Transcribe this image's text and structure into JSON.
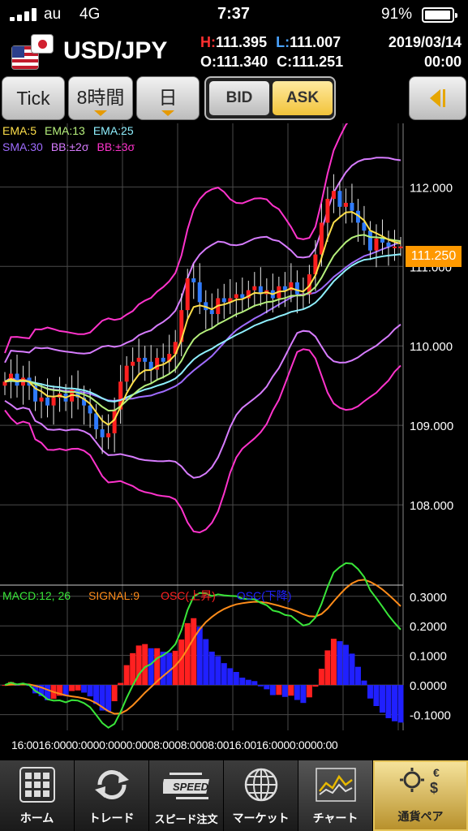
{
  "status_bar": {
    "carrier": "au",
    "network": "4G",
    "time": "7:37",
    "battery": "91%"
  },
  "header": {
    "pair": "USD/JPY",
    "high_label": "H:",
    "high": "111.395",
    "low_label": "L:",
    "low": "111.007",
    "open_label": "O:",
    "open": "111.340",
    "close_label": "C:",
    "close": "111.251",
    "date": "2019/03/14",
    "time": "00:00"
  },
  "toolbar": {
    "tick_label": "Tick",
    "timeframe_label": "8時間",
    "period_label": "日",
    "bid_label": "BID",
    "ask_label": "ASK",
    "selected_side": "ASK"
  },
  "legend_main": [
    {
      "label": "EMA:5",
      "color": "#ffe04a"
    },
    {
      "label": "EMA:13",
      "color": "#b6f07c"
    },
    {
      "label": "EMA:25",
      "color": "#8ff0ff"
    },
    {
      "label": "SMA:30",
      "color": "#9f6cff"
    },
    {
      "label": "BB:±2σ",
      "color": "#d77cff"
    },
    {
      "label": "BB:±3σ",
      "color": "#ff33cc"
    }
  ],
  "legend_sub": [
    {
      "label": "MACD:12, 26",
      "color": "#39e639"
    },
    {
      "label": "SIGNAL:9",
      "color": "#ff8c1a"
    },
    {
      "label": "OSC(上昇)",
      "color": "#ff2020"
    },
    {
      "label": "OSC(下降)",
      "color": "#2020ff"
    }
  ],
  "current_price": "111.250",
  "time_axis": "16:0016:0000:0000:0000:0008:0008:0008:0016:0016:0000:0000:00",
  "colors": {
    "up": "#ff2020",
    "down": "#2f7bff",
    "price_tag": "#ff9900",
    "grid": "#555555"
  },
  "chart_data": {
    "type": "line",
    "main_panel": {
      "ylim": [
        107.0,
        112.8
      ],
      "yticks": [
        "112.000",
        "111.000",
        "110.000",
        "109.000",
        "108.000"
      ],
      "ytick_values": [
        112.0,
        111.0,
        110.0,
        109.0,
        108.0
      ],
      "candles_close": [
        109.55,
        109.65,
        109.5,
        109.6,
        109.5,
        109.3,
        109.35,
        109.25,
        109.35,
        109.4,
        109.3,
        109.45,
        109.35,
        109.25,
        109.15,
        108.95,
        108.85,
        108.9,
        109.2,
        109.55,
        109.75,
        109.8,
        109.85,
        109.8,
        109.7,
        109.85,
        109.8,
        109.9,
        110.05,
        110.45,
        110.85,
        110.8,
        110.55,
        110.45,
        110.4,
        110.6,
        110.55,
        110.6,
        110.65,
        110.6,
        110.7,
        110.75,
        110.65,
        110.7,
        110.6,
        110.75,
        110.7,
        110.8,
        110.65,
        110.65,
        110.9,
        111.15,
        111.55,
        111.85,
        111.95,
        111.75,
        111.8,
        111.7,
        111.55,
        111.45,
        111.2,
        111.35,
        111.3,
        111.25,
        111.25,
        111.25
      ],
      "series": [
        {
          "name": "EMA:5",
          "color": "#ffe04a"
        },
        {
          "name": "EMA:13",
          "color": "#b6f07c"
        },
        {
          "name": "EMA:25",
          "color": "#8ff0ff"
        },
        {
          "name": "SMA:30",
          "color": "#9f6cff"
        },
        {
          "name": "BB:±2σ",
          "color": "#d77cff"
        },
        {
          "name": "BB:±3σ",
          "color": "#ff33cc"
        }
      ]
    },
    "macd_panel": {
      "ylim": [
        -0.145,
        0.335
      ],
      "yticks": [
        "0.3000",
        "0.2000",
        "0.1000",
        "0.0000",
        "-0.1000"
      ],
      "ytick_values": [
        0.3,
        0.2,
        0.1,
        0.0,
        -0.1
      ]
    }
  },
  "tabs": [
    {
      "label": "ホーム",
      "icon": "home-grid-icon"
    },
    {
      "label": "トレード",
      "icon": "trade-arrows-icon"
    },
    {
      "label": "スピード注文",
      "icon": "speed-icon"
    },
    {
      "label": "マーケット",
      "icon": "globe-icon"
    },
    {
      "label": "チャート",
      "icon": "chart-icon"
    },
    {
      "label": "通貨ペア",
      "icon": "currency-pair-icon"
    }
  ]
}
